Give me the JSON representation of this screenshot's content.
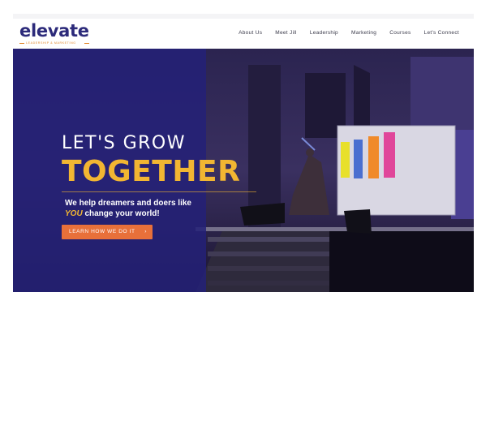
{
  "header": {
    "logo_text": "elevate",
    "logo_tagline": "LEADERSHIP & MARKETING",
    "nav": [
      "About Us",
      "Meet Jill",
      "Leadership",
      "Marketing",
      "Courses",
      "Let's Connect"
    ]
  },
  "hero": {
    "headline_1": "LET'S GROW",
    "headline_2": "TOGETHER",
    "sub_1": "We help dreamers and doers like",
    "sub_highlight": "YOU",
    "sub_2": " change your world!",
    "cta_label": "LEARN HOW WE DO IT",
    "cta_arrow": "›"
  },
  "colors": {
    "brand": "#2c2a7a",
    "accent_gold": "#f2b632",
    "cta": "#e8703a"
  }
}
